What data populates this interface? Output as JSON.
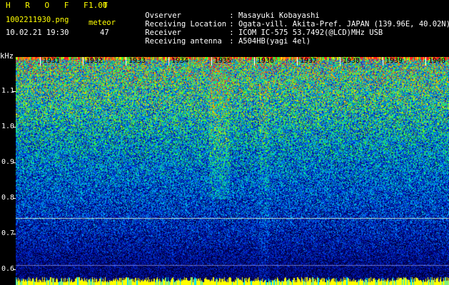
{
  "header": {
    "app_title": "H R O F F T",
    "app_version": "1.00",
    "file_name": "1002211930.png",
    "meteor_label": "meteor",
    "datetime": "10.02.21 19:30",
    "meteor_count": "47"
  },
  "info": [
    {
      "key": "Ovserver",
      "value": "Masayuki Kobayashi"
    },
    {
      "key": "Receiving Location",
      "value": "Ogata-vill. Akita-Pref. JAPAN (139.96E, 40.02N)"
    },
    {
      "key": "Receiver",
      "value": "ICOM IC-575 53.7492(@LCD)MHz USB"
    },
    {
      "key": "Receiving antenna",
      "value": "A504HB(yagi 4el)"
    }
  ],
  "axis": {
    "unit": "kHz",
    "y_labels": [
      "1.1",
      "1.0",
      "0.9",
      "0.8",
      "0.7",
      "0.6"
    ],
    "x_labels": [
      "1931",
      "1932",
      "1933",
      "1934",
      "1935",
      "1936",
      "1937",
      "1938",
      "1939",
      "1940"
    ]
  },
  "colors": {
    "header_yellow": "#ffff00",
    "header_white": "#ffffff",
    "header_cyan": "#00ffff",
    "background": "#000000"
  }
}
